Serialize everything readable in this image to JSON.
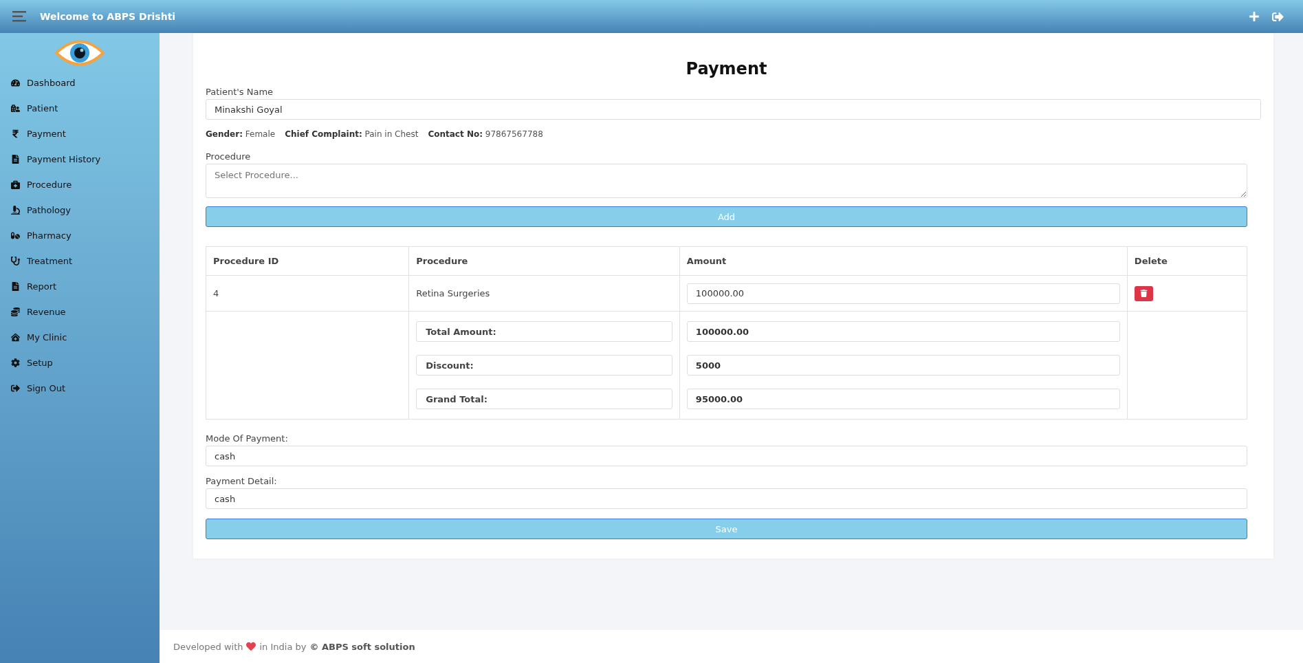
{
  "header": {
    "title": "Welcome to ABPS Drishti"
  },
  "sidebar": {
    "items": [
      "Dashboard",
      "Patient",
      "Payment",
      "Payment History",
      "Procedure",
      "Pathology",
      "Pharmacy",
      "Treatment",
      "Report",
      "Revenue",
      "My Clinic",
      "Setup",
      "Sign Out"
    ]
  },
  "form": {
    "title": "Payment",
    "patient_name": {
      "label": "Patient's Name",
      "value": "Minakshi Goyal"
    },
    "info": [
      "**Gender:** Female",
      "**Chief Complaint:** Pain in Chest",
      "**Contact No:** 97867567788"
    ],
    "procedure": {
      "label": "Procedure",
      "placeholder": "Select Procedure..."
    },
    "add_button": "Add",
    "table": {
      "columns": [
        "Procedure ID",
        "Procedure",
        "Amount",
        "Delete"
      ],
      "rows": [
        {
          "id": "4",
          "procedure": "Retina Surgeries",
          "amount": "100000.00"
        }
      ],
      "summary": [
        {
          "label": "Total Amount:",
          "value": "100000.00"
        },
        {
          "label": "Discount:",
          "value": "5000"
        },
        {
          "label": "Grand Total:",
          "value": "95000.00"
        }
      ]
    },
    "mode_of_payment": {
      "label": "Mode Of Payment:",
      "value": "cash"
    },
    "payment_detail": {
      "label": "Payment Detail:",
      "value": "cash"
    },
    "save_button": "Save"
  },
  "footer": {
    "before": "Developed with",
    "middle": "in India by",
    "brand": "© ABPS soft solution"
  }
}
